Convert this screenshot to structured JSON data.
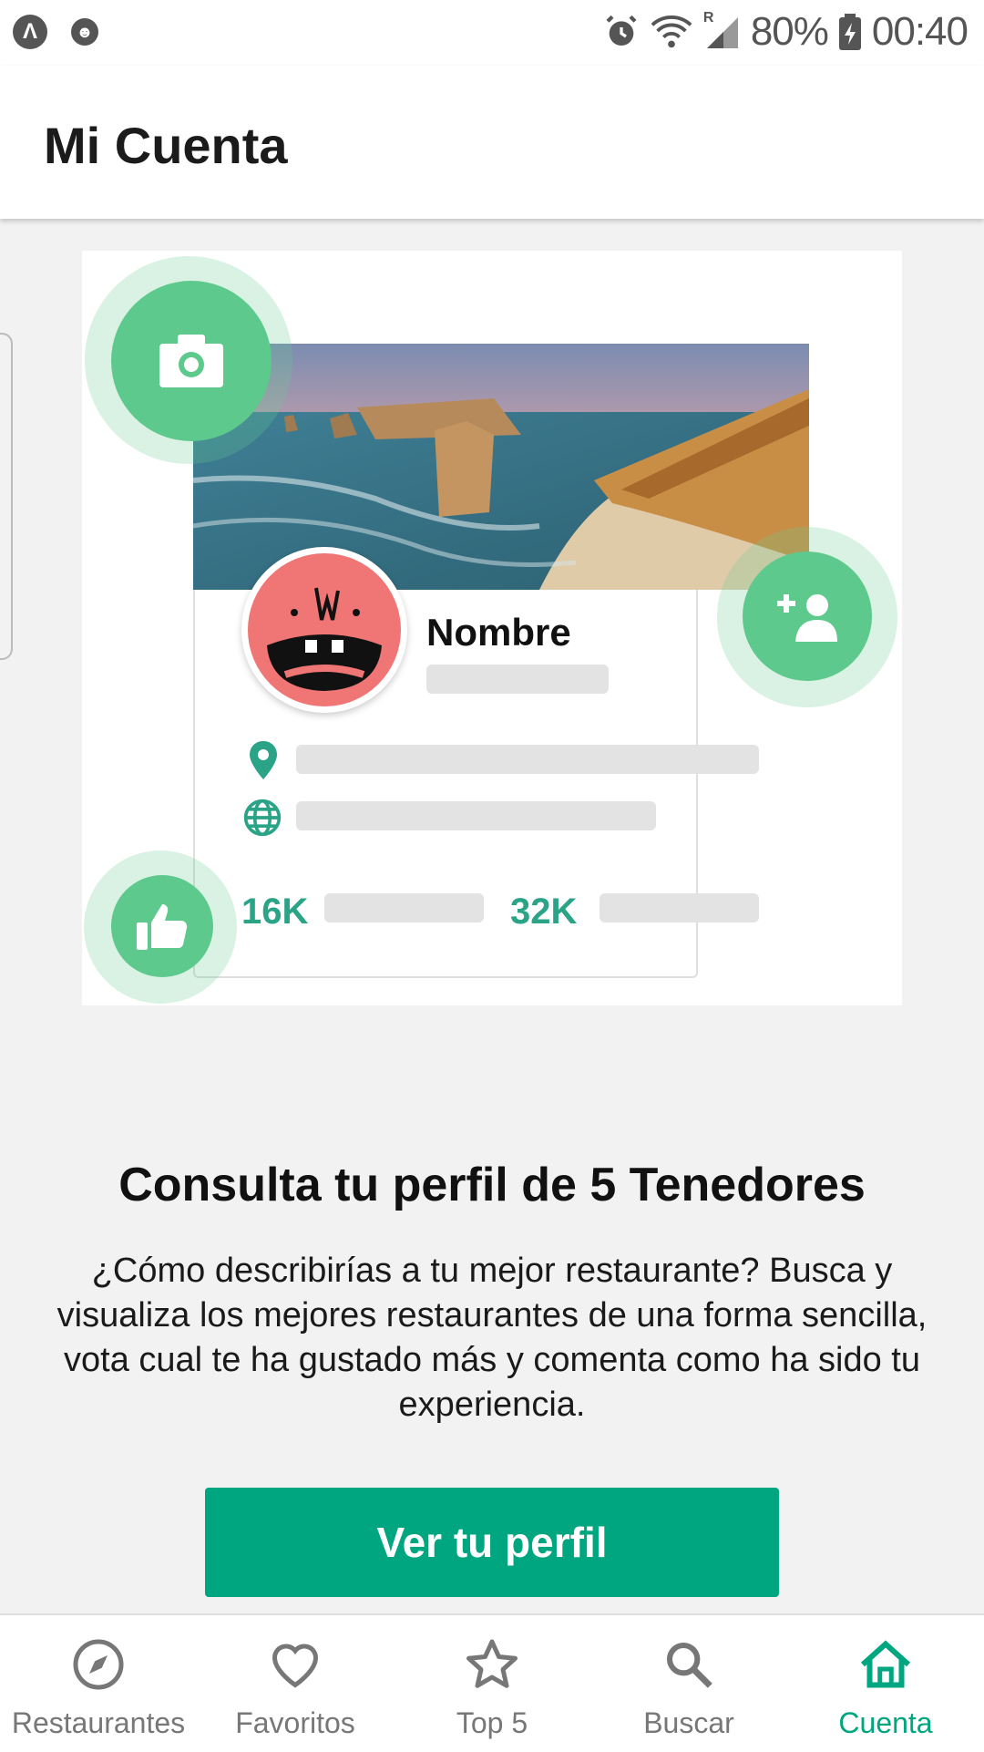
{
  "status_bar": {
    "battery": "80%",
    "time": "00:40",
    "network_badge": "R"
  },
  "app_bar": {
    "title": "Mi Cuenta"
  },
  "illustration": {
    "profile_name": "Nombre",
    "stat_1": "16K",
    "stat_2": "32K",
    "accent_color": "#5dc98c",
    "stat_color": "#2aa386"
  },
  "content": {
    "headline": "Consulta tu perfil de 5 Tenedores",
    "description": "¿Cómo describirías a tu mejor restaurante? Busca y visualiza los mejores restaurantes de una forma sencilla, vota cual te ha gustado más y comenta como ha sido tu experiencia.",
    "button_label": "Ver tu perfil",
    "button_color": "#00a680"
  },
  "bottom_nav": {
    "items": [
      {
        "label": "Restaurantes",
        "icon": "compass-icon",
        "active": false
      },
      {
        "label": "Favoritos",
        "icon": "heart-icon",
        "active": false
      },
      {
        "label": "Top 5",
        "icon": "star-icon",
        "active": false
      },
      {
        "label": "Buscar",
        "icon": "search-icon",
        "active": false
      },
      {
        "label": "Cuenta",
        "icon": "home-icon",
        "active": true
      }
    ],
    "active_color": "#00a680",
    "inactive_color": "#777777"
  }
}
